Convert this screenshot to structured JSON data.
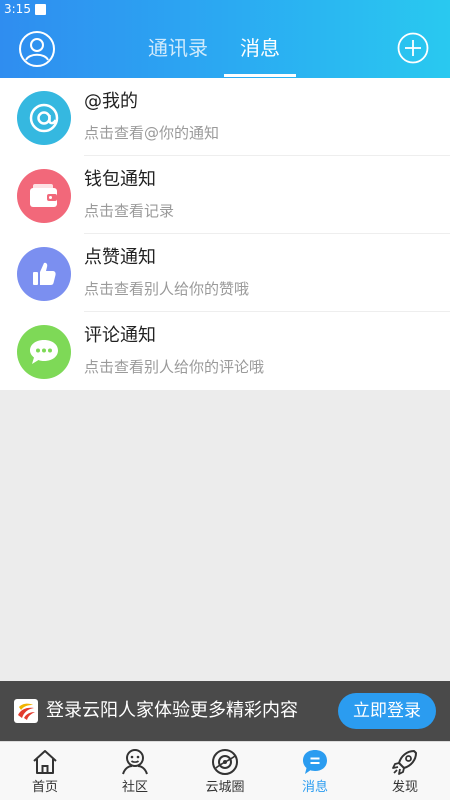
{
  "status_bar": {
    "time": "3:15"
  },
  "header": {
    "tabs": [
      {
        "label": "通讯录",
        "active": false
      },
      {
        "label": "消息",
        "active": true
      }
    ],
    "gradient": [
      "#2f8df0",
      "#29c9f0"
    ],
    "avatar_icon": "user-circle-icon",
    "add_icon": "plus-circle-icon"
  },
  "messages": [
    {
      "title": "@我的",
      "subtitle": "点击查看@你的通知",
      "icon": "at-icon",
      "color": "#35b8e0"
    },
    {
      "title": "钱包通知",
      "subtitle": "点击查看记录",
      "icon": "wallet-icon",
      "color": "#f2687a"
    },
    {
      "title": "点赞通知",
      "subtitle": "点击查看别人给你的赞哦",
      "icon": "thumbs-up-icon",
      "color": "#7b8ff0"
    },
    {
      "title": "评论通知",
      "subtitle": "点击查看别人给你的评论哦",
      "icon": "comment-icon",
      "color": "#7ed957"
    }
  ],
  "login_banner": {
    "text": "登录云阳人家体验更多精彩内容",
    "button": "立即登录"
  },
  "bottom_nav": [
    {
      "label": "首页",
      "icon": "home-icon",
      "active": false
    },
    {
      "label": "社区",
      "icon": "community-icon",
      "active": false
    },
    {
      "label": "云城圈",
      "icon": "cloud-city-circle-icon",
      "active": false
    },
    {
      "label": "消息",
      "icon": "message-icon",
      "active": true
    },
    {
      "label": "发现",
      "icon": "rocket-icon",
      "active": false
    }
  ],
  "colors": {
    "accent": "#2b9cf0",
    "banner_bg": "#4a4a4a"
  }
}
